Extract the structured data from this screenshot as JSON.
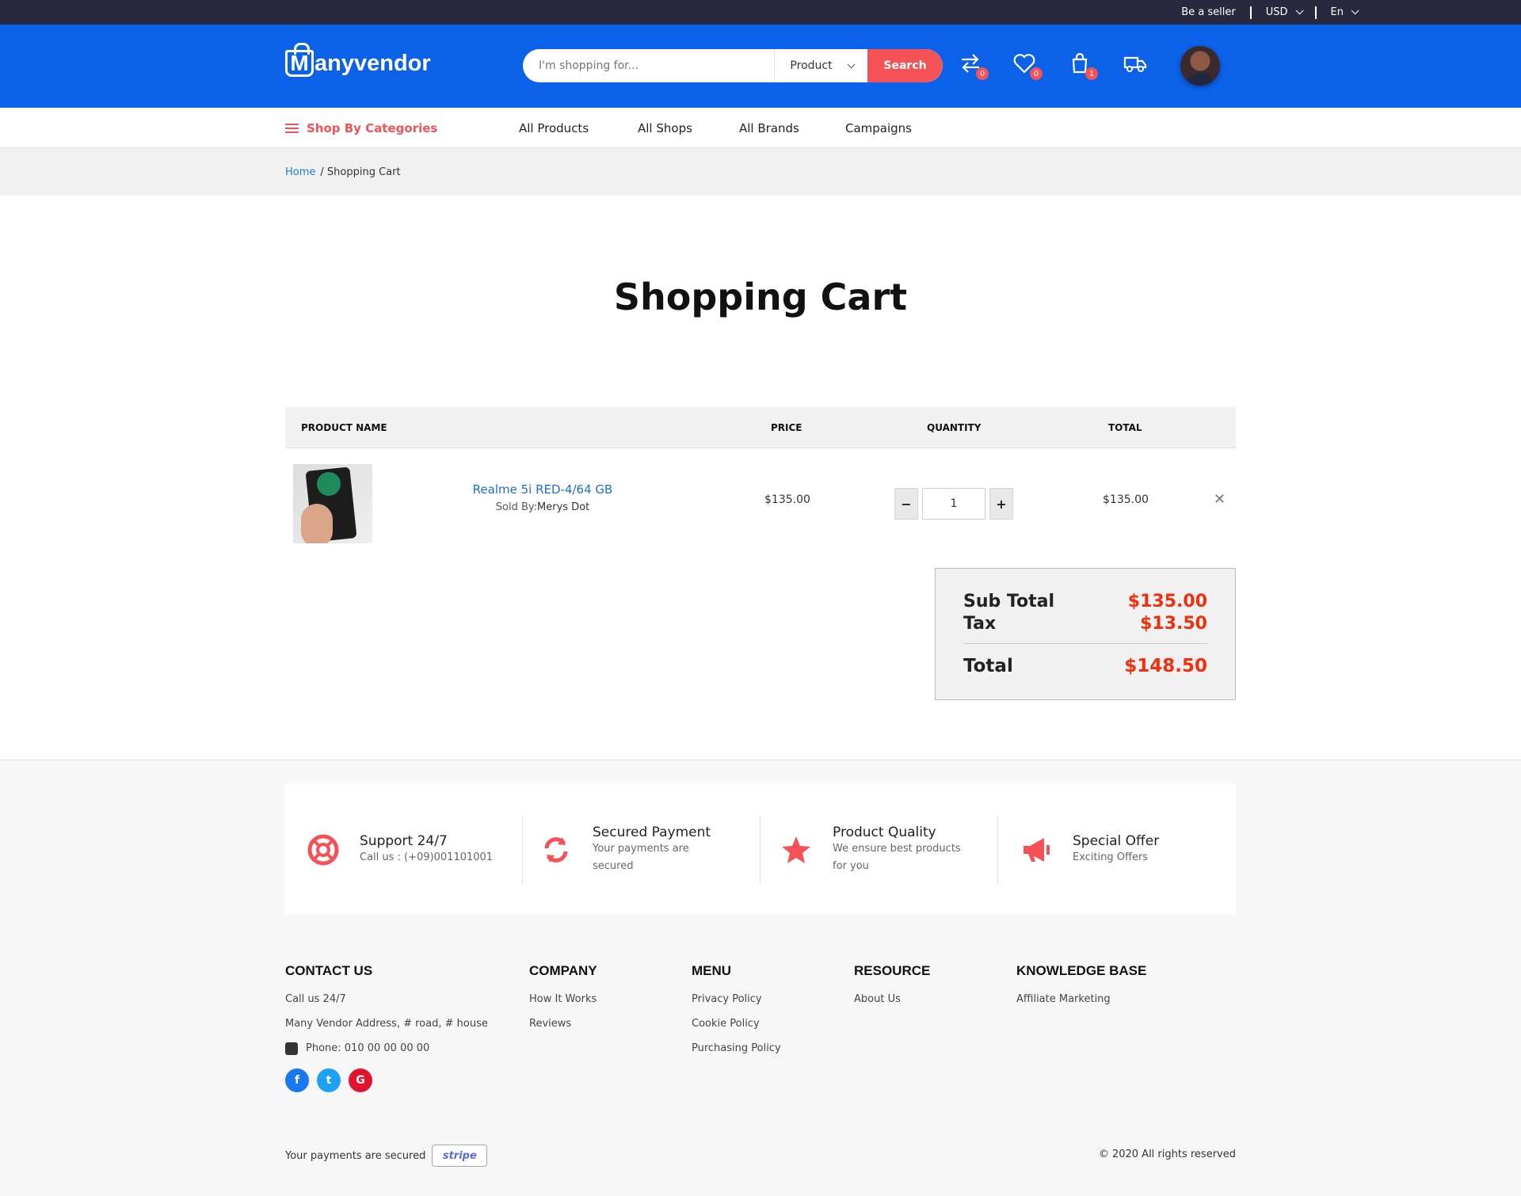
{
  "topbar": {
    "seller": "Be a seller",
    "currency": "USD",
    "language": "En"
  },
  "header": {
    "logo_letter": "M",
    "logo_text": "anyvendor",
    "search_placeholder": "I'm shopping for...",
    "search_scope": "Product",
    "search_button": "Search",
    "compare_count": "0",
    "wishlist_count": "0",
    "cart_count": "1"
  },
  "nav": {
    "categories": "Shop By Categories",
    "links": [
      "All Products",
      "All Shops",
      "All Brands",
      "Campaigns"
    ]
  },
  "breadcrumb": {
    "home": "Home",
    "current": "/ Shopping Cart"
  },
  "page_title": "Shopping Cart",
  "table": {
    "headers": [
      "PRODUCT NAME",
      "PRICE",
      "QUANTITY",
      "TOTAL"
    ],
    "rows": [
      {
        "name": "Realme 5i RED-4/64 GB",
        "sold_by_label": "Sold By:",
        "seller": "Merys Dot",
        "price": "$135.00",
        "quantity": "1",
        "total": "$135.00"
      }
    ]
  },
  "summary": {
    "subtotal_label": "Sub Total",
    "subtotal": "$135.00",
    "tax_label": "Tax",
    "tax": "$13.50",
    "total_label": "Total",
    "total": "$148.50"
  },
  "features": [
    {
      "title": "Support 24/7",
      "subtitle": "Call us : (+09)001101001"
    },
    {
      "title": "Secured Payment",
      "subtitle": "Your payments are secured"
    },
    {
      "title": "Product Quality",
      "subtitle": "We ensure best products for you"
    },
    {
      "title": "Special Offer",
      "subtitle": "Exciting Offers"
    }
  ],
  "footer": {
    "contact": {
      "heading": "CONTACT US",
      "call": "Call us 24/7",
      "address": "Many Vendor Address, # road, # house",
      "phone": "Phone: 010 00 00 00 00"
    },
    "company": {
      "heading": "COMPANY",
      "links": [
        "How It Works",
        "Reviews"
      ]
    },
    "menu": {
      "heading": "MENU",
      "links": [
        "Privacy Policy",
        "Cookie Policy",
        "Purchasing Policy"
      ]
    },
    "resource": {
      "heading": "RESOURCE",
      "links": [
        "About Us"
      ]
    },
    "knowledge": {
      "heading": "KNOWLEDGE BASE",
      "links": [
        "Affiliate Marketing"
      ]
    },
    "social": {
      "facebook": "f",
      "twitter": "t",
      "google": "G"
    },
    "payments_text": "Your payments are secured",
    "stripe_text": "stripe",
    "copyright": "© 2020 All rights reserved"
  },
  "colors": {
    "header": "#0c61e9",
    "accent": "#f55258",
    "price_red": "#f0300c",
    "topbar": "#29283f"
  },
  "icons": [
    "compare-icon",
    "heart-icon",
    "cart-icon",
    "truck-icon",
    "support-icon",
    "refresh-icon",
    "star-icon",
    "megaphone-icon",
    "phone-icon",
    "close-icon"
  ]
}
